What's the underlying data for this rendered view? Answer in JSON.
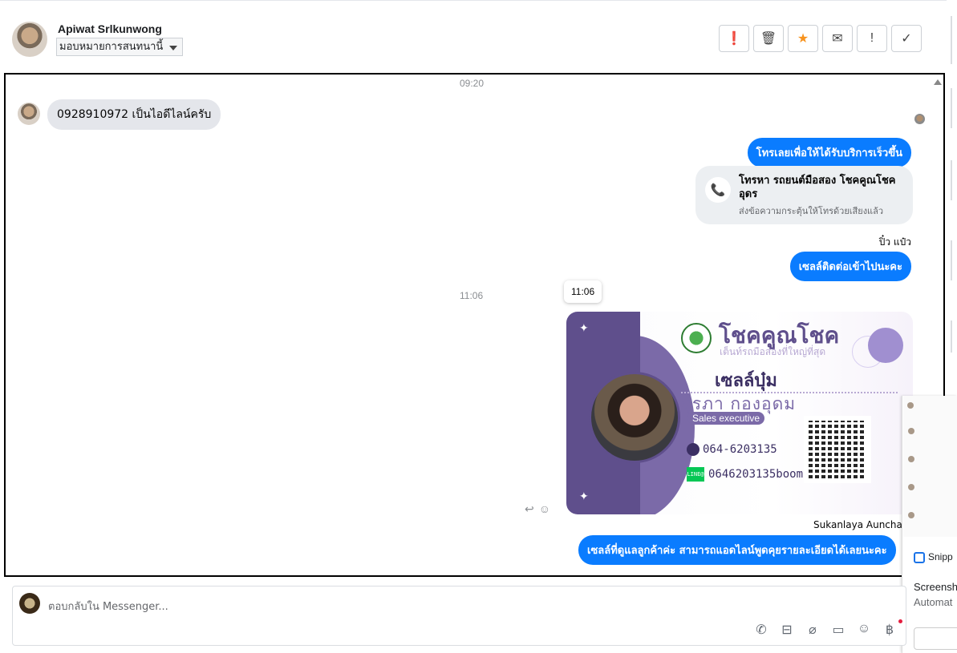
{
  "header": {
    "name": "Apiwat Srlkunwong",
    "assign_label": "มอบหมายการสนทนานี้",
    "actions": [
      {
        "icon": "alert-icon",
        "glyph": "❗"
      },
      {
        "icon": "trash-icon",
        "glyph": "🗑"
      },
      {
        "icon": "star-icon",
        "glyph": "★"
      },
      {
        "icon": "envelope-icon",
        "glyph": "✉"
      },
      {
        "icon": "exclamation-icon",
        "glyph": "!"
      },
      {
        "icon": "check-icon",
        "glyph": "✓"
      }
    ]
  },
  "chat": {
    "time1": "09:20",
    "incoming_1": "0928910972 เป็นไอดีไลน์ครับ",
    "outgoing_1": "โทรเลยเพื่อให้ได้รับบริการเร็วขึ้น",
    "call_card": {
      "title": "โทรหา รถยนต์มือสอง โชคคูณโชค อุดร",
      "subtitle": "ส่งข้อความกระตุ้นให้โทรด้วยเสียงแล้ว"
    },
    "sender_1": "ปิ๋ว แป๋ว",
    "outgoing_2": "เซลล์ติดต่อเข้าไปนะคะ",
    "time2": "11:06",
    "tooltip_time": "11:06",
    "business_card": {
      "brand": "โชคคูณโชค",
      "tagline": "เต็นท์รถมือสองที่ใหญ่ที่สุด",
      "nickname": "เซลล์บุ๋ม",
      "fullname": "สุรภา  กองอุดม",
      "role": "Sales executive",
      "phone": "064-6203135",
      "line_id": "0646203135boom",
      "line_badge": "LINE@"
    },
    "sender_2": "Sukanlaya Aunchabe",
    "outgoing_3": "เซลล์ที่ดูแลลูกค้าค่ะ  สามารถแอดไลน์พูดคุยรายละเอียดได้เลยนะคะ"
  },
  "composer": {
    "placeholder": "ตอบกลับใน Messenger...",
    "tools": [
      "phone-plus-icon",
      "shopping-bag-icon",
      "paperclip-icon",
      "chat-bubble-icon",
      "smiley-icon",
      "baht-icon"
    ]
  },
  "side_panel": {
    "snip_app": "Snipp",
    "snip_title": "Screensh",
    "snip_sub": "Automat"
  },
  "colors": {
    "messenger_blue": "#0a7cff",
    "incoming_gray": "#e4e6eb",
    "card_purple": "#5f4f8c",
    "star_orange": "#f7931e"
  }
}
